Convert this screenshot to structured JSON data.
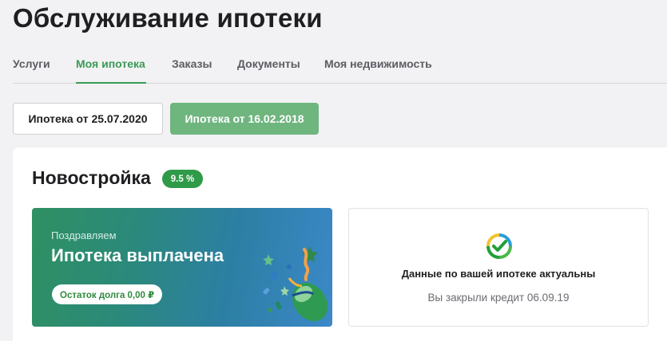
{
  "page": {
    "title": "Обслуживание ипотеки"
  },
  "tabs": [
    {
      "label": "Услуги",
      "active": false
    },
    {
      "label": "Моя ипотека",
      "active": true
    },
    {
      "label": "Заказы",
      "active": false
    },
    {
      "label": "Документы",
      "active": false
    },
    {
      "label": "Моя недвижимость",
      "active": false
    }
  ],
  "mortgages": [
    {
      "label": "Ипотека от 25.07.2020",
      "selected": false
    },
    {
      "label": "Ипотека от 16.02.2018",
      "selected": true
    }
  ],
  "card": {
    "title": "Новостройка",
    "rate_badge": "9.5 %",
    "promo": {
      "subtitle": "Поздравляем",
      "title": "Ипотека выплачена",
      "debt_label": "Остаток долга 0,00 ₽"
    },
    "status": {
      "icon": "sber-check-icon",
      "title": "Данные по вашей ипотеке актуальны",
      "subtitle": "Вы закрыли кредит 06.09.19"
    }
  },
  "colors": {
    "accent": "#3b9a55",
    "badge": "#2f9a47",
    "selected_button": "#6fb57e",
    "background": "#f2f2f4"
  }
}
